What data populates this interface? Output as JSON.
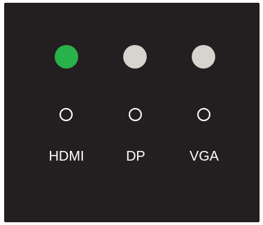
{
  "panel": {
    "background": "#231f20",
    "inputs": [
      {
        "label": "HDMI",
        "led_state": "active",
        "led_color": "#29b24a"
      },
      {
        "label": "DP",
        "led_state": "inactive",
        "led_color": "#d6d4cf"
      },
      {
        "label": "VGA",
        "led_state": "inactive",
        "led_color": "#d6d4cf"
      }
    ],
    "button_border_color": "#ffffff",
    "label_color": "#ffffff"
  }
}
